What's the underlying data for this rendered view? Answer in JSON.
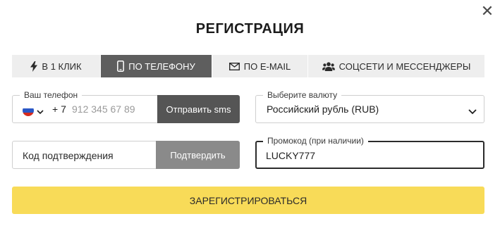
{
  "dialog": {
    "title": "РЕГИСТРАЦИЯ",
    "close_icon": "close-icon"
  },
  "tabs": [
    {
      "label": "В 1 КЛИК",
      "icon": "lightning-icon",
      "active": false
    },
    {
      "label": "ПО ТЕЛЕФОНУ",
      "icon": "phone-icon",
      "active": true
    },
    {
      "label": "ПО E-MAIL",
      "icon": "envelope-icon",
      "active": false
    },
    {
      "label": "СОЦСЕТИ И МЕССЕНДЖЕРЫ",
      "icon": "users-icon",
      "active": false
    }
  ],
  "phone": {
    "label": "Ваш телефон",
    "country_flag": "russia-flag-icon",
    "code": "+ 7",
    "placeholder": "912 345 67 89",
    "value": "",
    "send_button": "Отправить sms"
  },
  "currency": {
    "label": "Выберите валюту",
    "value": "Российский рубль (RUB)"
  },
  "confirm": {
    "placeholder": "Код подтверждения",
    "value": "",
    "button": "Подтвердить"
  },
  "promo": {
    "label": "Промокод (при наличии)",
    "value": "LUCKY777"
  },
  "register_button": "ЗАРЕГИСТРИРОВАТЬСЯ",
  "colors": {
    "accent_yellow": "#f8db58",
    "active_tab": "#5e5e5e",
    "sms_button": "#555555",
    "confirm_button": "#8a8a8a"
  }
}
